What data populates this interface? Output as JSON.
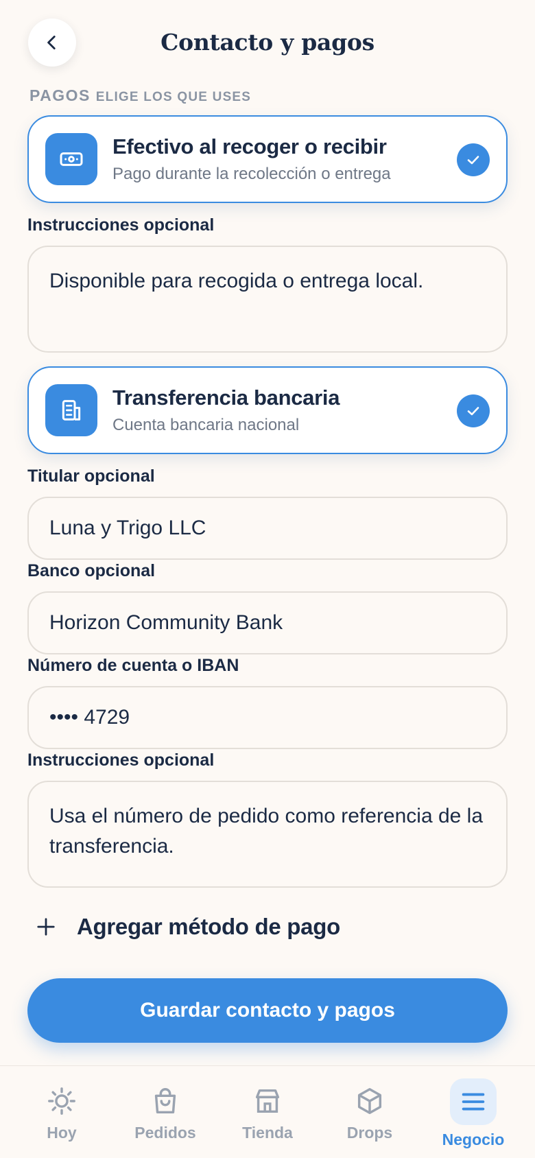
{
  "header": {
    "title": "Contacto y pagos"
  },
  "section": {
    "label": "PAGOS",
    "sublabel": "ELIGE LOS QUE USES"
  },
  "methods": {
    "cash": {
      "title": "Efectivo al recoger o recibir",
      "subtitle": "Pago durante la recolección o entrega",
      "instructions_label": "Instrucciones opcional",
      "instructions_value": "Disponible para recogida o entrega local."
    },
    "bank": {
      "title": "Transferencia bancaria",
      "subtitle": "Cuenta bancaria nacional",
      "holder_label": "Titular opcional",
      "holder_value": "Luna y Trigo LLC",
      "bank_label": "Banco opcional",
      "bank_value": "Horizon Community Bank",
      "account_label": "Número de cuenta o IBAN",
      "account_value": "•••• 4729",
      "instructions_label": "Instrucciones opcional",
      "instructions_value": "Usa el número de pedido como referencia de la transferencia."
    }
  },
  "add_method_label": "Agregar método de pago",
  "save_label": "Guardar contacto y pagos",
  "nav": [
    {
      "label": "Hoy",
      "icon": "sun-icon"
    },
    {
      "label": "Pedidos",
      "icon": "bag-icon"
    },
    {
      "label": "Tienda",
      "icon": "store-icon"
    },
    {
      "label": "Drops",
      "icon": "box-icon"
    },
    {
      "label": "Negocio",
      "icon": "menu-icon",
      "active": true
    }
  ],
  "colors": {
    "accent": "#3a8be0",
    "text": "#1b2a44",
    "muted": "#8a94a3",
    "background": "#fdf9f5"
  }
}
